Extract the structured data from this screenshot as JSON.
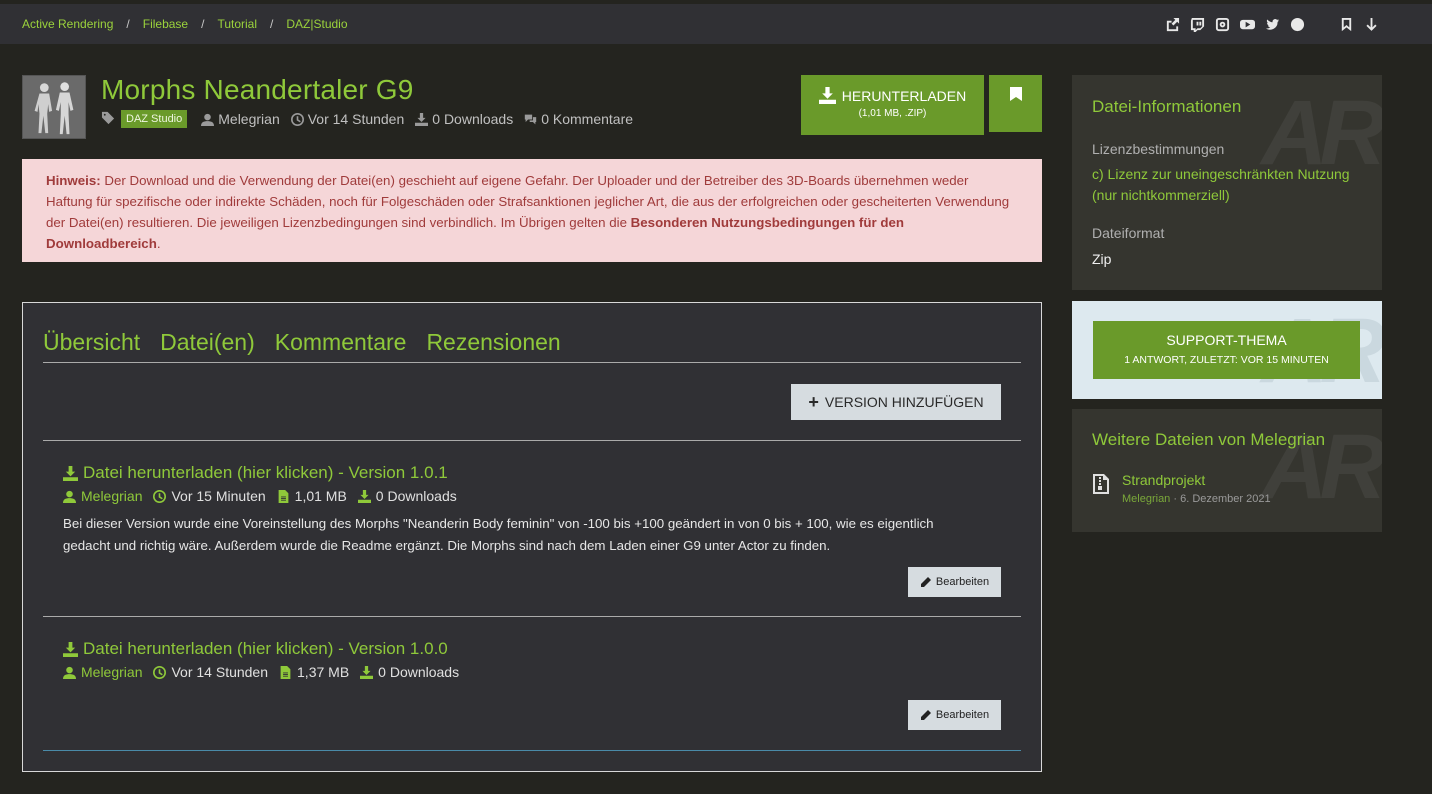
{
  "breadcrumbs": [
    "Active Rendering",
    "Filebase",
    "Tutorial",
    "DAZ|Studio"
  ],
  "breadcrumb_separator": "/",
  "top_icons": [
    "share-icon",
    "twitch-icon",
    "instagram-icon",
    "youtube-icon",
    "twitter-icon",
    "facebook-icon",
    "bookmark-icon",
    "arrow-down-icon"
  ],
  "file": {
    "title": "Morphs Neandertaler G9",
    "tag": "DAZ Studio",
    "author": "Melegrian",
    "time": "Vor 14 Stunden",
    "downloads": "0 Downloads",
    "comments": "0 Kommentare"
  },
  "download_button": {
    "label": "HERUNTERLADEN",
    "sub": "(1,01 MB, .ZIP)"
  },
  "notice": {
    "label": "Hinweis:",
    "text": " Der Download und die Verwendung der Datei(en) geschieht auf eigene Gefahr. Der Uploader und der Betreiber des 3D-Boards übernehmen weder Haftung für spezifische oder indirekte Schäden, noch für Folgeschäden oder Strafsanktionen jeglicher Art, die aus der erfolgreichen oder gescheiterten Verwendung der Datei(en) resultieren. Die jeweiligen Lizenzbedingungen sind verbindlich. Im Übrigen gelten die ",
    "link": "Besonderen Nutzungsbedingungen für den Downloadbereich",
    "end": "."
  },
  "tabs": [
    "Übersicht",
    "Datei(en)",
    "Kommentare",
    "Rezensionen"
  ],
  "active_tab": "Datei(en)",
  "add_version_label": "VERSION HINZUFÜGEN",
  "versions": [
    {
      "title": "Datei herunterladen (hier klicken) - Version 1.0.1",
      "author": "Melegrian",
      "time": "Vor 15 Minuten",
      "size": "1,01 MB",
      "downloads": "0 Downloads",
      "description": "Bei dieser Version wurde eine Voreinstellung des Morphs \"Neanderin Body feminin\" von -100 bis +100 geändert in von 0 bis + 100, wie es eigentlich gedacht und richtig wäre. Außerdem wurde die Readme ergänzt. Die Morphs sind nach dem Laden einer G9 unter Actor zu finden.",
      "edit_label": "Bearbeiten"
    },
    {
      "title": "Datei herunterladen (hier klicken) - Version 1.0.0",
      "author": "Melegrian",
      "time": "Vor 14 Stunden",
      "size": "1,37 MB",
      "downloads": "0 Downloads",
      "description": "",
      "edit_label": "Bearbeiten"
    }
  ],
  "sidebar": {
    "watermark": "AR",
    "info": {
      "title": "Datei-Informationen",
      "license_label": "Lizenzbestimmungen",
      "license_value": "c) Lizenz zur uneingeschränkten Nutzung (nur nichtkommerziell)",
      "format_label": "Dateiformat",
      "format_value": "Zip"
    },
    "support": {
      "label": "SUPPORT-THEMA",
      "sub": "1 ANTWORT, ZULETZT: VOR 15 MINUTEN"
    },
    "more": {
      "title": "Weitere Dateien von Melegrian",
      "item_name": "Strandprojekt",
      "item_author": "Melegrian",
      "item_date": " · 6. Dezember 2021"
    }
  },
  "colors": {
    "accent": "#8fc93a",
    "button_green": "#6a9a2a",
    "notice_bg": "#f5d6d8",
    "notice_text": "#a03b3b",
    "panel_bg": "#303034",
    "page_bg": "#24241f"
  }
}
